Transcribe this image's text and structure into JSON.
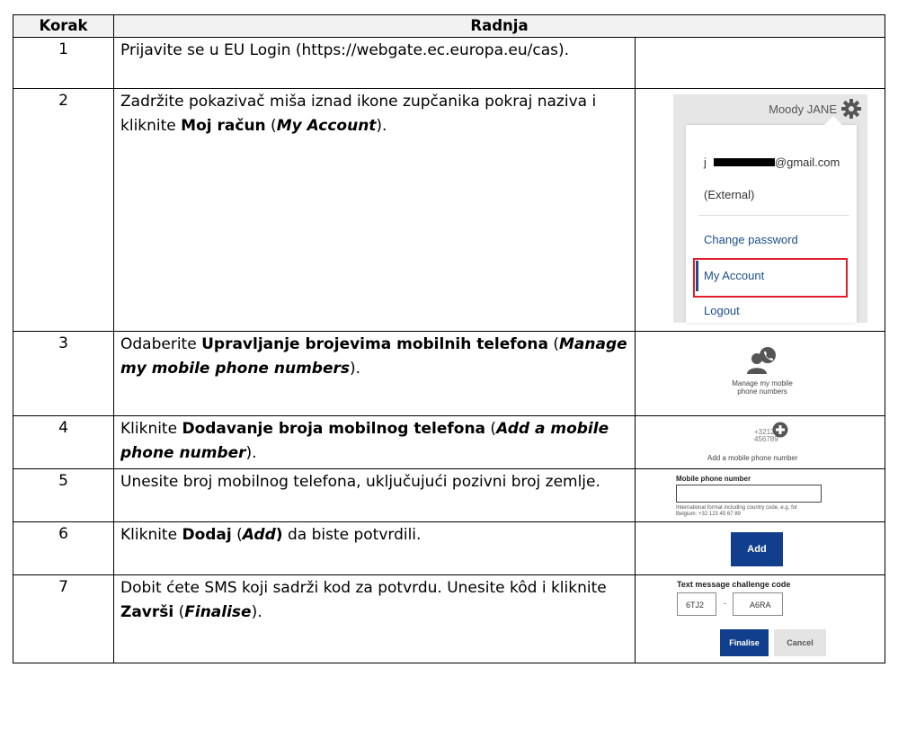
{
  "header": {
    "col_step": "Korak",
    "col_action": "Radnja"
  },
  "rows": [
    {
      "num": "1",
      "text_a": "Prijavite se u EU Login (https://webgate.ec.europa.eu/cas)."
    },
    {
      "num": "2",
      "text_a": "Zadržite pokazivač miša iznad ikone zupčanika pokraj naziva i kliknite ",
      "bold": "Moj račun",
      "paren_open": " (",
      "bold_italic": "My Account",
      "paren_close": ")."
    },
    {
      "num": "3",
      "text_a": "Odaberite ",
      "bold": "Upravljanje brojevima mobilnih telefona",
      "paren_open": " (",
      "bold_italic": "Manage my mobile phone numbers",
      "paren_close": ")."
    },
    {
      "num": "4",
      "text_a": "Kliknite ",
      "bold": "Dodavanje broja mobilnog telefona",
      "paren_open": " (",
      "bold_italic": "Add a mobile phone number",
      "paren_close": ")."
    },
    {
      "num": "5",
      "text_a": "Unesite broj mobilnog telefona, uključujući pozivni broj zemlje."
    },
    {
      "num": "6",
      "text_a": "Kliknite ",
      "bold": "Dodaj",
      "paren_open": " (",
      "bold_italic": "Add",
      "paren_close": ")",
      "text_b": " da biste potvrdili."
    },
    {
      "num": "7",
      "text_a": "Dobit ćete SMS koji sadrži kod za potvrdu. Unesite kôd i kliknite ",
      "bold": "Završi",
      "paren_open": " (",
      "bold_italic": "Finalise",
      "paren_close": ")."
    }
  ],
  "menu": {
    "user": "Moody JANE",
    "email_prefix": "j",
    "email_suffix": "@gmail.com",
    "external": "(External)",
    "change_password": "Change password",
    "my_account": "My Account",
    "logout": "Logout"
  },
  "manage_phone": {
    "caption_line1": "Manage my mobile",
    "caption_line2": "phone numbers"
  },
  "add_phone": {
    "digits_line1": "+3212",
    "digits_line2": "456789",
    "caption": "Add a mobile phone number"
  },
  "phone_form": {
    "label": "Mobile phone number",
    "help_line1": "International format including country code, e.g. for",
    "help_line2": "Belgium: +32 123 45 67 89"
  },
  "add_button": {
    "label": "Add"
  },
  "challenge": {
    "title": "Text message challenge code",
    "code1": "6TJ2",
    "dash": "-",
    "code2": "A6RA",
    "finalise": "Finalise",
    "cancel": "Cancel"
  },
  "colors": {
    "accent_blue": "#123f8d",
    "link_blue": "#1a4f8a",
    "highlight_red": "#e31d2b"
  },
  "icons": [
    "gear-icon",
    "phone-user-icon",
    "plus-circle-icon"
  ]
}
